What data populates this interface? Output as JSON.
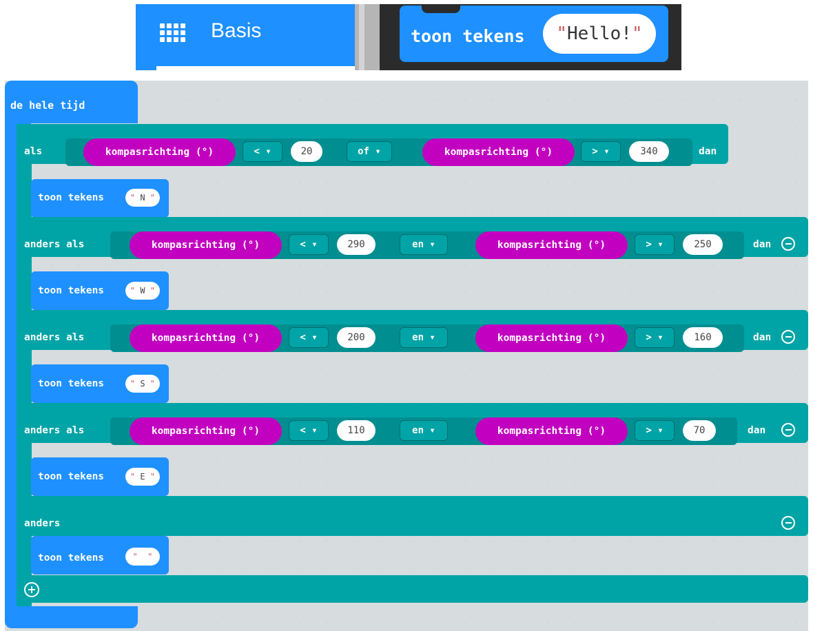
{
  "category": {
    "label": "Basis"
  },
  "sample": {
    "label": "toon tekens",
    "value": "Hello!"
  },
  "forever": {
    "label": "de hele tijd"
  },
  "if": {
    "label": "als",
    "then": "dan",
    "clauses": [
      {
        "left": "kompasrichting (°)",
        "left_op": "< ▾",
        "left_value": "20",
        "join": "of ▾",
        "right": "kompasrichting (°)",
        "right_op": "> ▾",
        "right_value": "340"
      },
      {
        "left": "kompasrichting (°)",
        "left_op": "< ▾",
        "left_value": "290",
        "join": "en ▾",
        "right": "kompasrichting (°)",
        "right_op": "> ▾",
        "right_value": "250"
      },
      {
        "left": "kompasrichting (°)",
        "left_op": "< ▾",
        "left_value": "200",
        "join": "en ▾",
        "right": "kompasrichting (°)",
        "right_op": "> ▾",
        "right_value": "160"
      },
      {
        "left": "kompasrichting (°)",
        "left_op": "< ▾",
        "left_value": "110",
        "join": "en ▾",
        "right": "kompasrichting (°)",
        "right_op": "> ▾",
        "right_value": "70"
      }
    ],
    "else_if_label": "anders als",
    "else_label": "anders"
  },
  "shows": [
    {
      "label": "toon tekens",
      "value": "N"
    },
    {
      "label": "toon tekens",
      "value": "W"
    },
    {
      "label": "toon tekens",
      "value": "S"
    },
    {
      "label": "toon tekens",
      "value": "E"
    },
    {
      "label": "toon tekens",
      "value": ""
    }
  ],
  "colors": {
    "basic": "#1e90ff",
    "logic": "#00a4a6",
    "input": "#c200c0",
    "workspace": "#ecf0f1"
  }
}
